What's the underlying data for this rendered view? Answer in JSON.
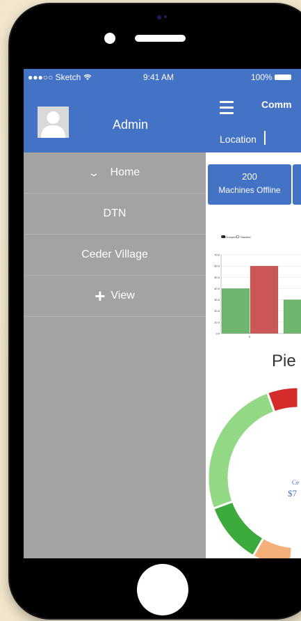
{
  "status_bar": {
    "carrier": "●●●○○ Sketch",
    "wifi_icon": "wifi-icon",
    "time": "9:41 AM",
    "battery": "100%"
  },
  "sidebar": {
    "user": "Admin",
    "items": [
      {
        "label": "Home",
        "icon": "chevron-down-icon"
      },
      {
        "label": "DTN"
      },
      {
        "label": "Ceder Village"
      },
      {
        "label": "View",
        "icon": "plus-icon"
      }
    ]
  },
  "header": {
    "title": "Comm",
    "location_label": "Location"
  },
  "tile": {
    "value": "200",
    "label": "Machines Offline"
  },
  "bar_chart": {
    "legend": [
      "Grouped",
      "Stacked"
    ]
  },
  "chart_data": [
    {
      "type": "bar",
      "categories": [
        "0"
      ],
      "series": [
        {
          "values": [
            40
          ]
        },
        {
          "values": [
            60
          ]
        },
        {
          "values": [
            30
          ]
        }
      ],
      "yticks": [
        "0.0",
        "10.0",
        "20.0",
        "30.0",
        "40.0",
        "50.0",
        "60.0",
        "70.0"
      ],
      "ylim": [
        0,
        70
      ],
      "colors": [
        "#6eb56e",
        "#cc5757",
        "#6eb56e"
      ],
      "legend": [
        "Grouped",
        "Stacked"
      ]
    },
    {
      "type": "pie",
      "title": "Pie",
      "center_label": "Ce",
      "center_value": "$7",
      "colors": [
        "#d42b2b",
        "#93d985",
        "#3caa3c",
        "#f5b07a"
      ]
    }
  ],
  "pie_chart": {
    "title": "Pie",
    "center_label": "Ce",
    "center_value": "$7"
  },
  "colors": {
    "primary": "#4472c4",
    "sidebar_bg": "#a3a3a3"
  }
}
